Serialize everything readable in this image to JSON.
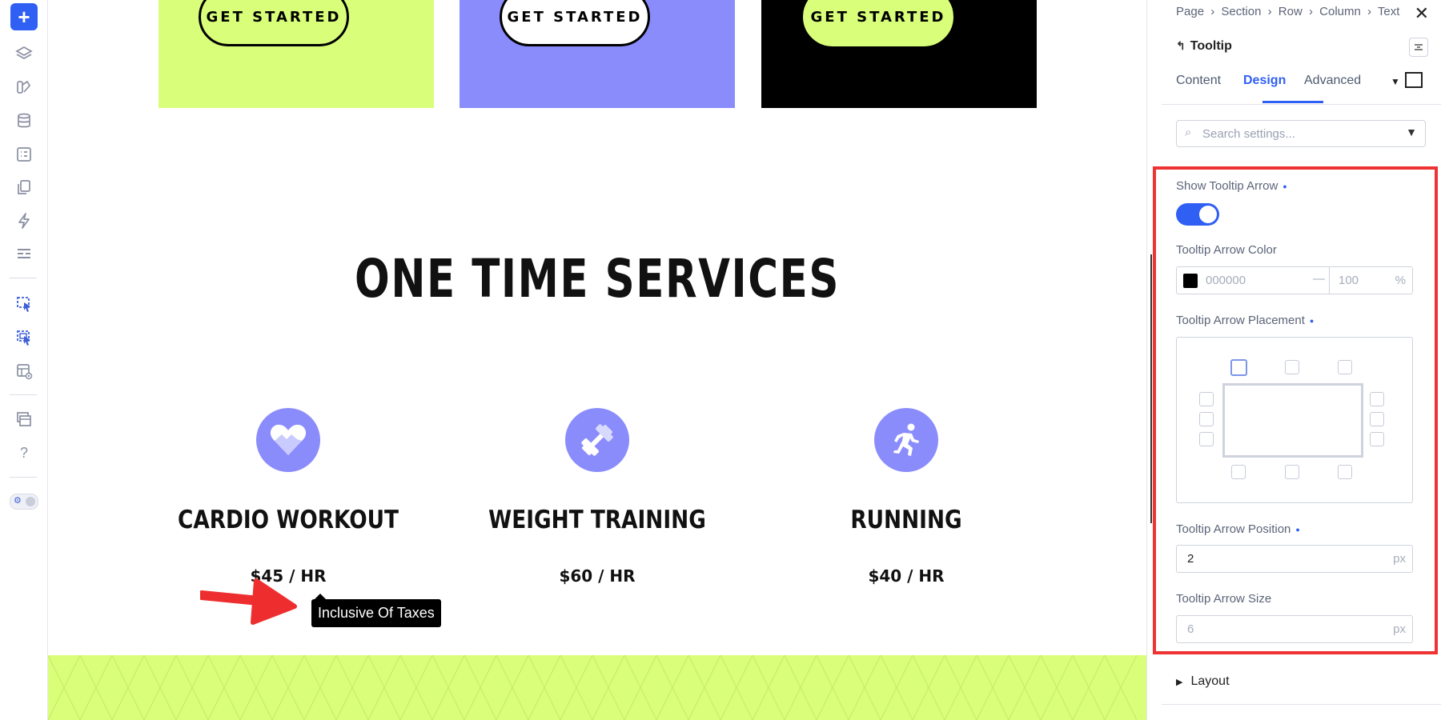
{
  "toolbar": {
    "add_label": "+",
    "help_label": "?"
  },
  "cards": [
    {
      "button_label": "GET STARTED",
      "bg": "#d9ff7a",
      "btn_bg": "#d9ff7a",
      "btn_fg": "#000",
      "btn_border": "#000"
    },
    {
      "button_label": "GET STARTED",
      "bg": "#8a8cfb",
      "btn_bg": "#ffffff",
      "btn_fg": "#000",
      "btn_border": "#000"
    },
    {
      "button_label": "GET STARTED",
      "bg": "#000000",
      "btn_bg": "#d9ff7a",
      "btn_fg": "#000",
      "btn_border": "#d9ff7a"
    }
  ],
  "headline": "ONE TIME SERVICES",
  "services": [
    {
      "title": "CARDIO WORKOUT",
      "price": "$45 / HR",
      "icon": "heart-icon"
    },
    {
      "title": "WEIGHT TRAINING",
      "price": "$60 / HR",
      "icon": "dumbbell-icon"
    },
    {
      "title": "RUNNING",
      "price": "$40 / HR",
      "icon": "runner-icon"
    }
  ],
  "tooltip": {
    "text": "Inclusive Of Taxes"
  },
  "colors": {
    "accent": "#2f5ff3",
    "lime": "#d9ff7a",
    "purple": "#8a8cfb",
    "highlight": "#e33333"
  },
  "panel": {
    "breadcrumb": [
      "Page",
      "Section",
      "Row",
      "Column",
      "Text"
    ],
    "breadcrumb_sep": "›",
    "title": "Tooltip",
    "tabs": [
      {
        "label": "Content",
        "active": false
      },
      {
        "label": "Design",
        "active": true
      },
      {
        "label": "Advanced",
        "active": false
      }
    ],
    "search_placeholder": "Search settings...",
    "show_arrow": {
      "label": "Show Tooltip Arrow",
      "enabled": true
    },
    "arrow_color": {
      "label": "Tooltip Arrow Color",
      "hex": "000000",
      "dash": "—",
      "opacity": "100",
      "opacity_unit": "%"
    },
    "arrow_placement": {
      "label": "Tooltip Arrow Placement",
      "selected": "top-left"
    },
    "arrow_position": {
      "label": "Tooltip Arrow Position",
      "value": "2",
      "unit": "px"
    },
    "arrow_size": {
      "label": "Tooltip Arrow Size",
      "placeholder": "6",
      "unit": "px"
    },
    "layout_label": "Layout"
  }
}
